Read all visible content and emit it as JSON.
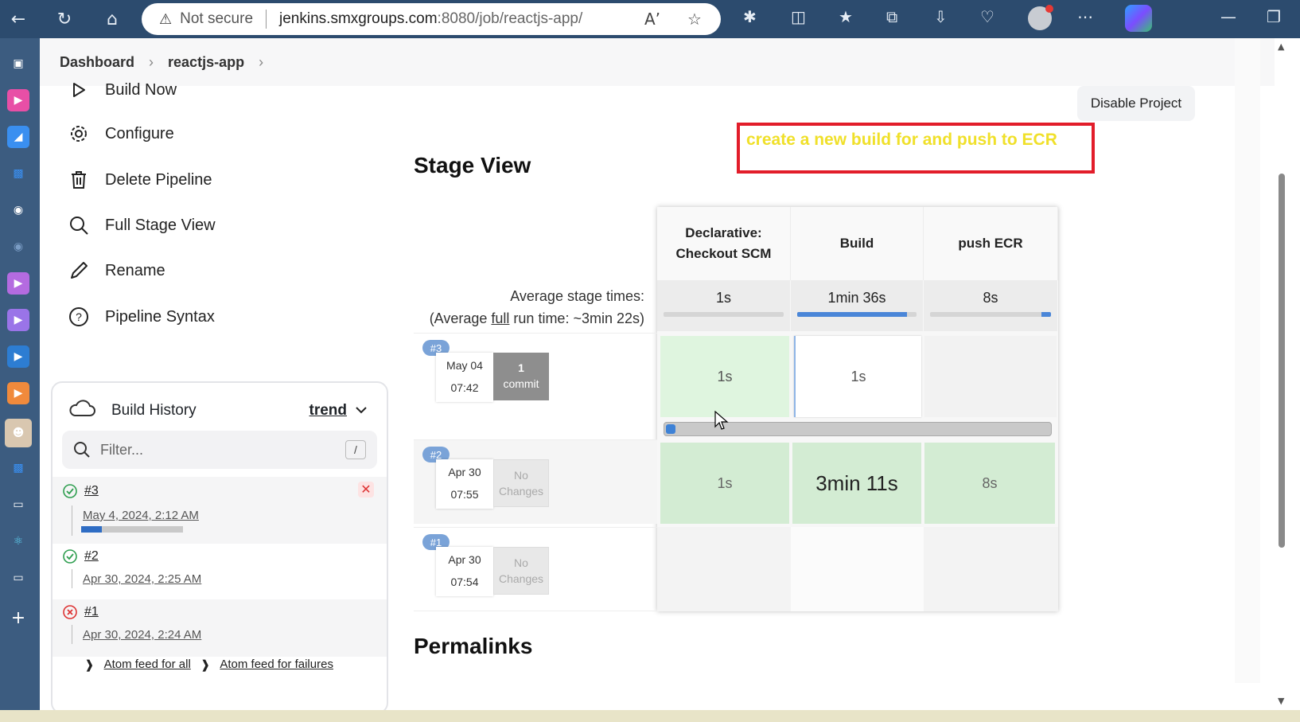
{
  "browser": {
    "security_label": "Not secure",
    "url_host": "jenkins.smxgroups.com",
    "url_rest": ":8080/job/reactjs-app/"
  },
  "breadcrumb": {
    "items": [
      "Dashboard",
      "reactjs-app"
    ]
  },
  "tasks": [
    {
      "label": "Build Now",
      "icon": "play-icon"
    },
    {
      "label": "Configure",
      "icon": "gear-icon"
    },
    {
      "label": "Delete Pipeline",
      "icon": "trash-icon"
    },
    {
      "label": "Full Stage View",
      "icon": "search-icon"
    },
    {
      "label": "Rename",
      "icon": "pencil-icon"
    },
    {
      "label": "Pipeline Syntax",
      "icon": "help-icon"
    }
  ],
  "history": {
    "title": "Build History",
    "trend_label": "trend",
    "filter_placeholder": "Filter...",
    "filter_shortcut": "/",
    "builds": [
      {
        "number": "#3",
        "date": "May 4, 2024, 2:12 AM",
        "status": "success",
        "progress": 0.2,
        "cancelable": true
      },
      {
        "number": "#2",
        "date": "Apr 30, 2024, 2:25 AM",
        "status": "success"
      },
      {
        "number": "#1",
        "date": "Apr 30, 2024, 2:24 AM",
        "status": "failed"
      }
    ],
    "feed_all": "Atom feed for all",
    "feed_failures": "Atom feed for failures"
  },
  "main": {
    "disable_button": "Disable Project",
    "annotation": "create a new build for and push to ECR",
    "stage_view_title": "Stage View",
    "permalinks_title": "Permalinks",
    "avg_label_line1": "Average stage times:",
    "avg_label_prefix": "(Average ",
    "avg_label_link": "full",
    "avg_label_suffix": " run time: ~3min 22s)"
  },
  "stages": {
    "headers": [
      "Declarative: Checkout SCM",
      "Build",
      "push ECR"
    ],
    "avg_times": [
      "1s",
      "1min 36s",
      "8s"
    ],
    "avg_progress": [
      0.0,
      0.92,
      0.08
    ]
  },
  "runs": [
    {
      "badge": "#3",
      "month_day": "May 04",
      "time": "07:42",
      "changes_line1": "1",
      "changes_line2": "commit",
      "cells": [
        "1s",
        "1s",
        ""
      ],
      "progress": 0.02
    },
    {
      "badge": "#2",
      "month_day": "Apr 30",
      "time": "07:55",
      "changes_line1": "No",
      "changes_line2": "Changes",
      "cells": [
        "1s",
        "3min 11s",
        "8s"
      ]
    },
    {
      "badge": "#1",
      "month_day": "Apr 30",
      "time": "07:54",
      "changes_line1": "No",
      "changes_line2": "Changes",
      "cells": [
        "",
        "",
        ""
      ]
    }
  ],
  "colors": {
    "success_cell": "#d6efd6",
    "running_cell": "#ffffff",
    "annotation_border": "#e21d2a",
    "annotation_text": "#f0e02a"
  }
}
